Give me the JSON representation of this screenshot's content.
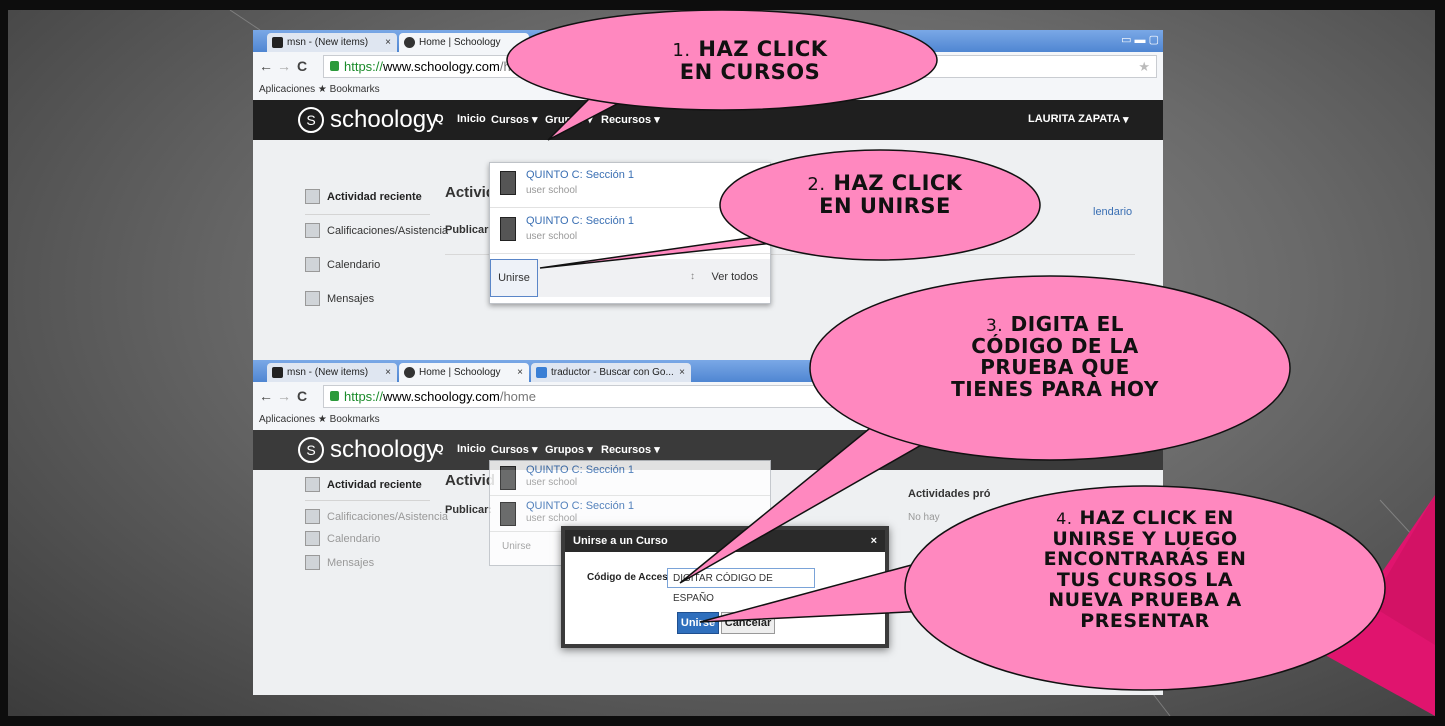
{
  "colors": {
    "bubble_fill": "#ff88bf",
    "bubble_stroke": "#111111",
    "schoology_bar": "#1f1f1f",
    "accent_blue": "#3a6fb3",
    "pink_wedge": "#e0146e"
  },
  "browser": {
    "tab1": "msn - (New items)",
    "tab2": "Home | Schoology",
    "tab3": "traductor - Buscar con Go...",
    "close_glyph": "×",
    "back": "←",
    "forward": "→",
    "reload": "C",
    "url_scheme": "https://",
    "url_host": "www.schoology.com",
    "url_path": "/home",
    "bookmarks": "Aplicaciones  ★ Bookmarks",
    "star": "★"
  },
  "schoology": {
    "logo": "schoology",
    "logo_mark": "S",
    "nav_search": "Q",
    "nav_inicio": "Inicio",
    "nav_cursos": "Cursos ▾",
    "nav_grupos": "Grupos ▾",
    "nav_recursos": "Recursos ▾",
    "user": "LAURITA ZAPATA",
    "user_caret": "▾",
    "sidebar": [
      "Actividad reciente",
      "Calificaciones/Asistencia",
      "Calendario",
      "Mensajes"
    ],
    "heading": "Activid",
    "publish": "Publicar:",
    "courses": [
      {
        "title": "QUINTO C: Sección 1",
        "sub": "user school"
      },
      {
        "title": "QUINTO C: Sección 1",
        "sub": "user school"
      }
    ],
    "join": "Unirse",
    "view_all": "Ver todos",
    "calendar_link": "lendario",
    "upcoming": "Actividades pró",
    "no_items": "No hay"
  },
  "modal": {
    "title": "Unirse a un Curso",
    "close": "×",
    "label": "Código de Acceso :",
    "required": "*",
    "input_value": "DIGITAR CÓDIGO DE ESPAÑO",
    "join_button": "Unirse",
    "cancel_button": "Cancelar"
  },
  "callouts": {
    "step1": {
      "num": "1.",
      "lines": [
        "HAZ CLICK",
        "EN CURSOS"
      ]
    },
    "step2": {
      "num": "2.",
      "lines": [
        "HAZ CLICK",
        "EN UNIRSE"
      ]
    },
    "step3": {
      "num": "3.",
      "lines": [
        "DIGITA EL",
        "CÓDIGO DE LA",
        "PRUEBA QUE",
        "TIENES PARA HOY"
      ]
    },
    "step4": {
      "num": "4.",
      "lines": [
        "HAZ CLICK EN",
        "UNIRSE Y LUEGO",
        "ENCONTRARÁS EN",
        "TUS CURSOS LA",
        "NUEVA PRUEBA A",
        "PRESENTAR"
      ]
    }
  }
}
